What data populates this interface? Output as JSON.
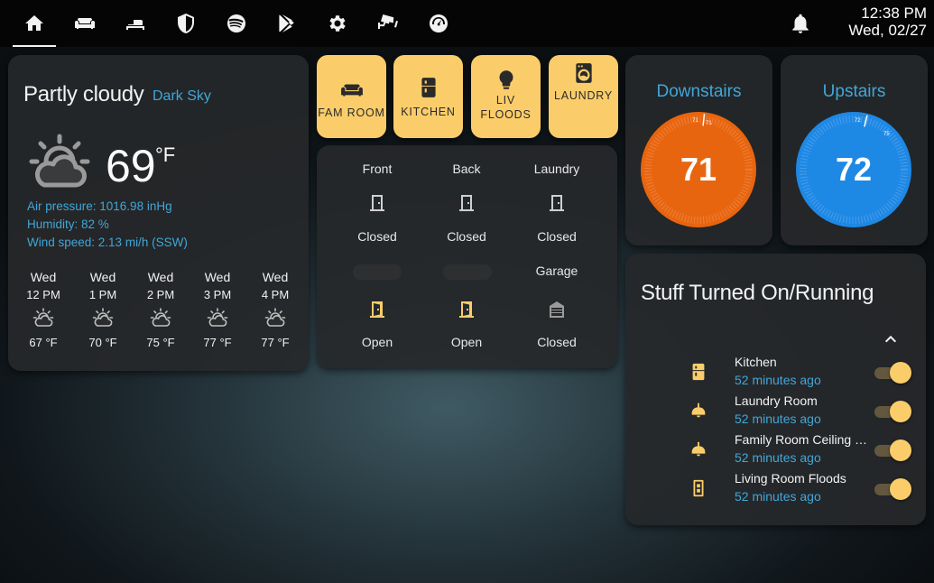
{
  "topbar": {
    "tabs": [
      {
        "icon": "home-icon",
        "active": true
      },
      {
        "icon": "sofa-icon",
        "active": false
      },
      {
        "icon": "bed-icon",
        "active": false
      },
      {
        "icon": "shield-icon",
        "active": false
      },
      {
        "icon": "spotify-icon",
        "active": false
      },
      {
        "icon": "google-play-icon",
        "active": false
      },
      {
        "icon": "gear-icon",
        "active": false
      },
      {
        "icon": "cctv-icon",
        "active": false
      },
      {
        "icon": "speedometer-icon",
        "active": false
      }
    ],
    "notification_icon": "bell-icon",
    "time": "12:38 PM",
    "date": "Wed, 02/27"
  },
  "weather": {
    "condition": "Partly cloudy",
    "source": "Dark Sky",
    "icon": "partly-cloudy-icon",
    "temperature": "69",
    "unit": "°F",
    "attributes": [
      "Air pressure: 1016.98 inHg",
      "Humidity: 82 %",
      "Wind speed: 2.13 mi/h (SSW)"
    ],
    "forecast": [
      {
        "day": "Wed",
        "hour": "12 PM",
        "temp": "67 °F"
      },
      {
        "day": "Wed",
        "hour": "1 PM",
        "temp": "70 °F"
      },
      {
        "day": "Wed",
        "hour": "2 PM",
        "temp": "75 °F"
      },
      {
        "day": "Wed",
        "hour": "3 PM",
        "temp": "77 °F"
      },
      {
        "day": "Wed",
        "hour": "4 PM",
        "temp": "77 °F"
      }
    ]
  },
  "rooms": [
    {
      "label": "FAM ROOM",
      "icon": "sofa-icon"
    },
    {
      "label": "KITCHEN",
      "icon": "fridge-icon"
    },
    {
      "label_line1": "LIV",
      "label_line2": "FLOODS",
      "icon": "lightbulb-icon"
    },
    {
      "label": "LAUNDRY",
      "icon": "washing-machine-icon"
    }
  ],
  "doors": {
    "top": [
      {
        "name": "Front",
        "state": "Closed"
      },
      {
        "name": "Back",
        "state": "Closed"
      },
      {
        "name": "Laundry",
        "state": "Closed"
      }
    ],
    "garage_label": "Garage",
    "bottom": [
      {
        "state": "Open"
      },
      {
        "state": "Open"
      },
      {
        "state": "Closed"
      }
    ],
    "colors": {
      "closed": "#cfcfcf",
      "open": "#fbcd6a"
    }
  },
  "thermostats": [
    {
      "name": "Downstairs",
      "value": "71",
      "small_a": "71",
      "small_b": "71",
      "color": "#e8650f"
    },
    {
      "name": "Upstairs",
      "value": "72",
      "small_a": "72",
      "small_b": "75",
      "color": "#1e88e5"
    }
  ],
  "stuff": {
    "title": "Stuff Turned On/Running",
    "items": [
      {
        "name": "Kitchen",
        "time": "52 minutes ago",
        "icon": "fridge-icon",
        "on": true
      },
      {
        "name": "Laundry Room",
        "time": "52 minutes ago",
        "icon": "ceiling-light-icon",
        "on": true
      },
      {
        "name": "Family Room Ceiling Light",
        "time": "52 minutes ago",
        "icon": "ceiling-light-icon",
        "on": true
      },
      {
        "name": "Living Room Floods",
        "time": "52 minutes ago",
        "icon": "light-switch-icon",
        "on": true
      }
    ]
  },
  "colors": {
    "accent": "#fbcd6a",
    "link": "#41a6d8"
  }
}
